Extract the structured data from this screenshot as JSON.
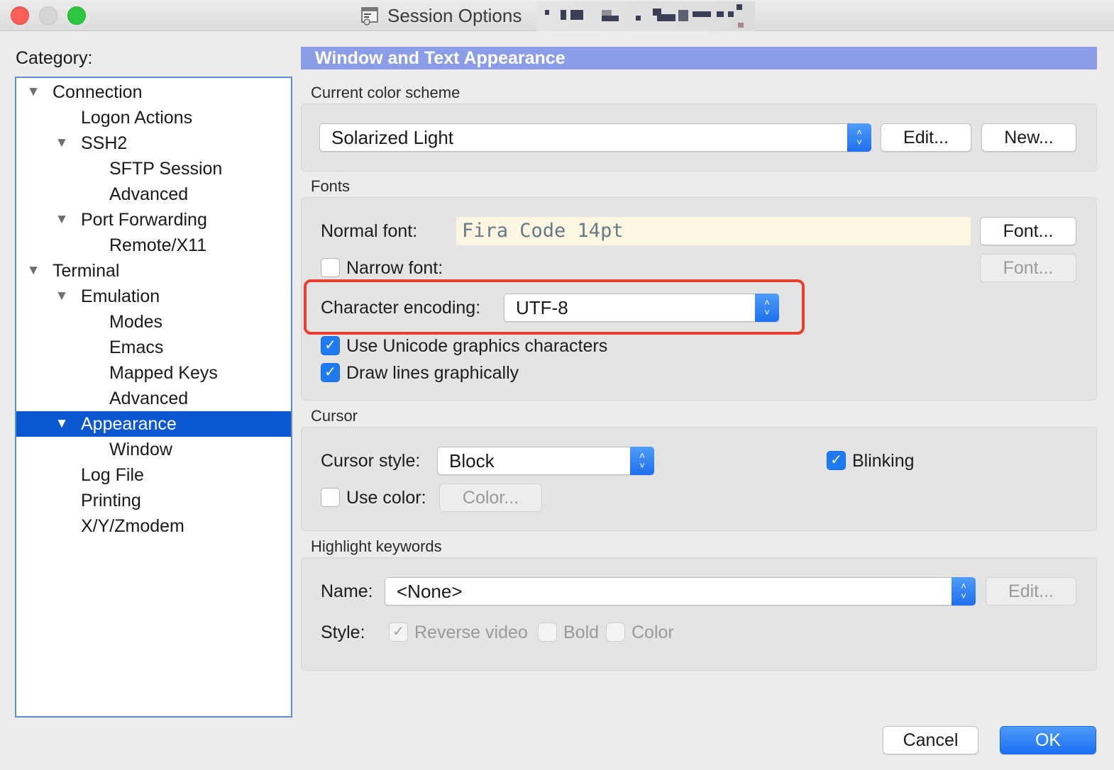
{
  "window": {
    "title": "Session Options"
  },
  "colors": {
    "accent": "#0a57d1",
    "header": "#8a9de6",
    "highlight_border": "#ea3e2e",
    "font_preview_bg": "#fdf6e3"
  },
  "category": {
    "label": "Category:",
    "items": [
      {
        "label": "Connection",
        "level": 0,
        "expanded": true
      },
      {
        "label": "Logon Actions",
        "level": 1
      },
      {
        "label": "SSH2",
        "level": 1,
        "expanded": true
      },
      {
        "label": "SFTP Session",
        "level": 2
      },
      {
        "label": "Advanced",
        "level": 2
      },
      {
        "label": "Port Forwarding",
        "level": 1,
        "expanded": true
      },
      {
        "label": "Remote/X11",
        "level": 2
      },
      {
        "label": "Terminal",
        "level": 0,
        "expanded": true
      },
      {
        "label": "Emulation",
        "level": 1,
        "expanded": true
      },
      {
        "label": "Modes",
        "level": 2
      },
      {
        "label": "Emacs",
        "level": 2
      },
      {
        "label": "Mapped Keys",
        "level": 2
      },
      {
        "label": "Advanced",
        "level": 2
      },
      {
        "label": "Appearance",
        "level": 1,
        "expanded": true,
        "selected": true
      },
      {
        "label": "Window",
        "level": 2
      },
      {
        "label": "Log File",
        "level": 1
      },
      {
        "label": "Printing",
        "level": 1
      },
      {
        "label": "X/Y/Zmodem",
        "level": 1
      }
    ]
  },
  "panel": {
    "title": "Window and Text Appearance",
    "color_scheme": {
      "group_label": "Current color scheme",
      "selected": "Solarized Light",
      "edit_label": "Edit...",
      "new_label": "New..."
    },
    "fonts": {
      "group_label": "Fonts",
      "normal_font_label": "Normal font:",
      "normal_font_value": "Fira Code 14pt",
      "font_button": "Font...",
      "narrow_font_label": "Narrow font:",
      "narrow_font_checked": false,
      "narrow_font_button": "Font...",
      "encoding_label": "Character encoding:",
      "encoding_value": "UTF-8",
      "unicode_label": "Use Unicode graphics characters",
      "unicode_checked": true,
      "draw_lines_label": "Draw lines graphically",
      "draw_lines_checked": true
    },
    "cursor": {
      "group_label": "Cursor",
      "style_label": "Cursor style:",
      "style_value": "Block",
      "blinking_label": "Blinking",
      "blinking_checked": true,
      "use_color_label": "Use color:",
      "use_color_checked": false,
      "color_button": "Color..."
    },
    "highlight": {
      "group_label": "Highlight keywords",
      "name_label": "Name:",
      "name_value": "<None>",
      "edit_label": "Edit...",
      "style_label": "Style:",
      "reverse_label": "Reverse video",
      "reverse_checked": true,
      "bold_label": "Bold",
      "bold_checked": false,
      "color_label": "Color",
      "color_checked": false
    }
  },
  "footer": {
    "cancel_label": "Cancel",
    "ok_label": "OK"
  }
}
